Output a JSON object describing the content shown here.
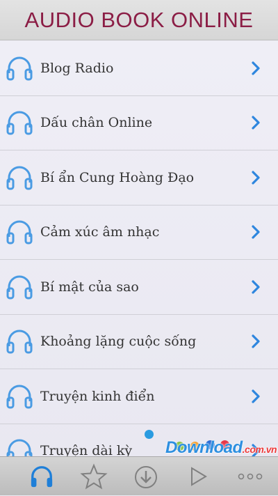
{
  "header": {
    "title": "AUDIO BOOK ONLINE"
  },
  "list": {
    "items": [
      {
        "label": "Blog Radio"
      },
      {
        "label": "Dấu chân Online"
      },
      {
        "label": "Bí ẩn Cung Hoàng Đạo"
      },
      {
        "label": "Cảm xúc âm nhạc"
      },
      {
        "label": "Bí mật của sao"
      },
      {
        "label": "Khoảng lặng cuộc sống"
      },
      {
        "label": "Truyện kinh điển"
      },
      {
        "label": "Truyện dài kỳ"
      }
    ],
    "item_icon": "headphones-icon",
    "chevron_icon": "chevron-right-icon"
  },
  "tabbar": {
    "tabs": [
      {
        "icon": "headphones-icon",
        "active": true
      },
      {
        "icon": "star-icon",
        "active": false
      },
      {
        "icon": "download-icon",
        "active": false
      },
      {
        "icon": "play-icon",
        "active": false
      },
      {
        "icon": "more-icon",
        "active": false
      }
    ]
  },
  "watermark": {
    "text": "Download",
    "suffix": ".com.vn"
  },
  "colors": {
    "title": "#8b1d45",
    "accent_blue": "#2e86de",
    "icon_blue": "#4a9be3",
    "dots": [
      "#2a9be0",
      "#8bc34a",
      "#f6a02c",
      "#2d6fd6",
      "#e8394a"
    ]
  }
}
